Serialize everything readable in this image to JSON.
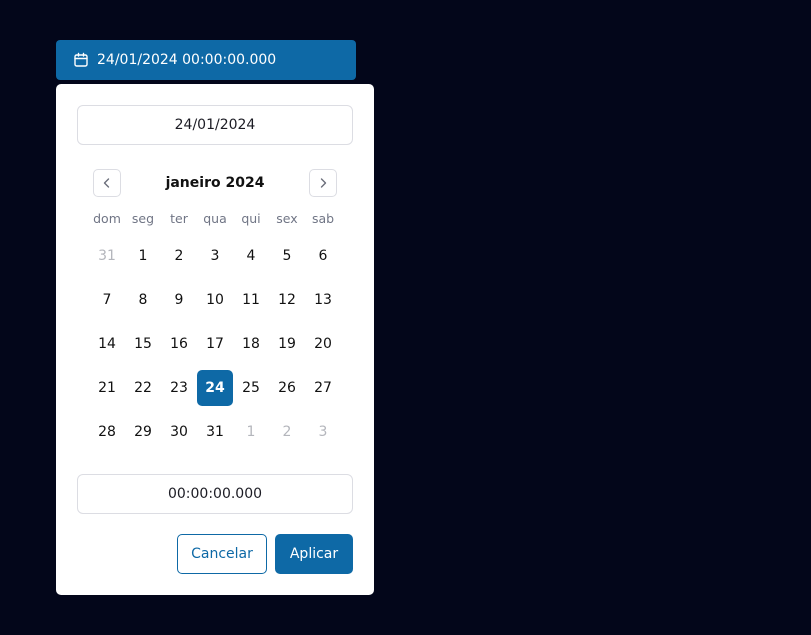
{
  "colors": {
    "accent": "#0e69a6",
    "background": "#03061a"
  },
  "trigger": {
    "icon": "calendar-icon",
    "value": "24/01/2024 00:00:00.000"
  },
  "date_input": {
    "value": "24/01/2024"
  },
  "calendar": {
    "month_label": "janeiro 2024",
    "prev_icon": "chevron-left-icon",
    "next_icon": "chevron-right-icon",
    "weekdays": [
      "dom",
      "seg",
      "ter",
      "qua",
      "qui",
      "sex",
      "sab"
    ],
    "weeks": [
      [
        {
          "d": "31",
          "outside": true
        },
        {
          "d": "1"
        },
        {
          "d": "2"
        },
        {
          "d": "3"
        },
        {
          "d": "4"
        },
        {
          "d": "5"
        },
        {
          "d": "6"
        }
      ],
      [
        {
          "d": "7"
        },
        {
          "d": "8"
        },
        {
          "d": "9"
        },
        {
          "d": "10"
        },
        {
          "d": "11"
        },
        {
          "d": "12"
        },
        {
          "d": "13"
        }
      ],
      [
        {
          "d": "14"
        },
        {
          "d": "15"
        },
        {
          "d": "16"
        },
        {
          "d": "17"
        },
        {
          "d": "18"
        },
        {
          "d": "19"
        },
        {
          "d": "20"
        }
      ],
      [
        {
          "d": "21"
        },
        {
          "d": "22"
        },
        {
          "d": "23"
        },
        {
          "d": "24",
          "selected": true
        },
        {
          "d": "25"
        },
        {
          "d": "26"
        },
        {
          "d": "27"
        }
      ],
      [
        {
          "d": "28"
        },
        {
          "d": "29"
        },
        {
          "d": "30"
        },
        {
          "d": "31"
        },
        {
          "d": "1",
          "outside": true
        },
        {
          "d": "2",
          "outside": true
        },
        {
          "d": "3",
          "outside": true
        }
      ]
    ]
  },
  "time_input": {
    "value": "00:00:00.000"
  },
  "actions": {
    "cancel_label": "Cancelar",
    "apply_label": "Aplicar"
  }
}
